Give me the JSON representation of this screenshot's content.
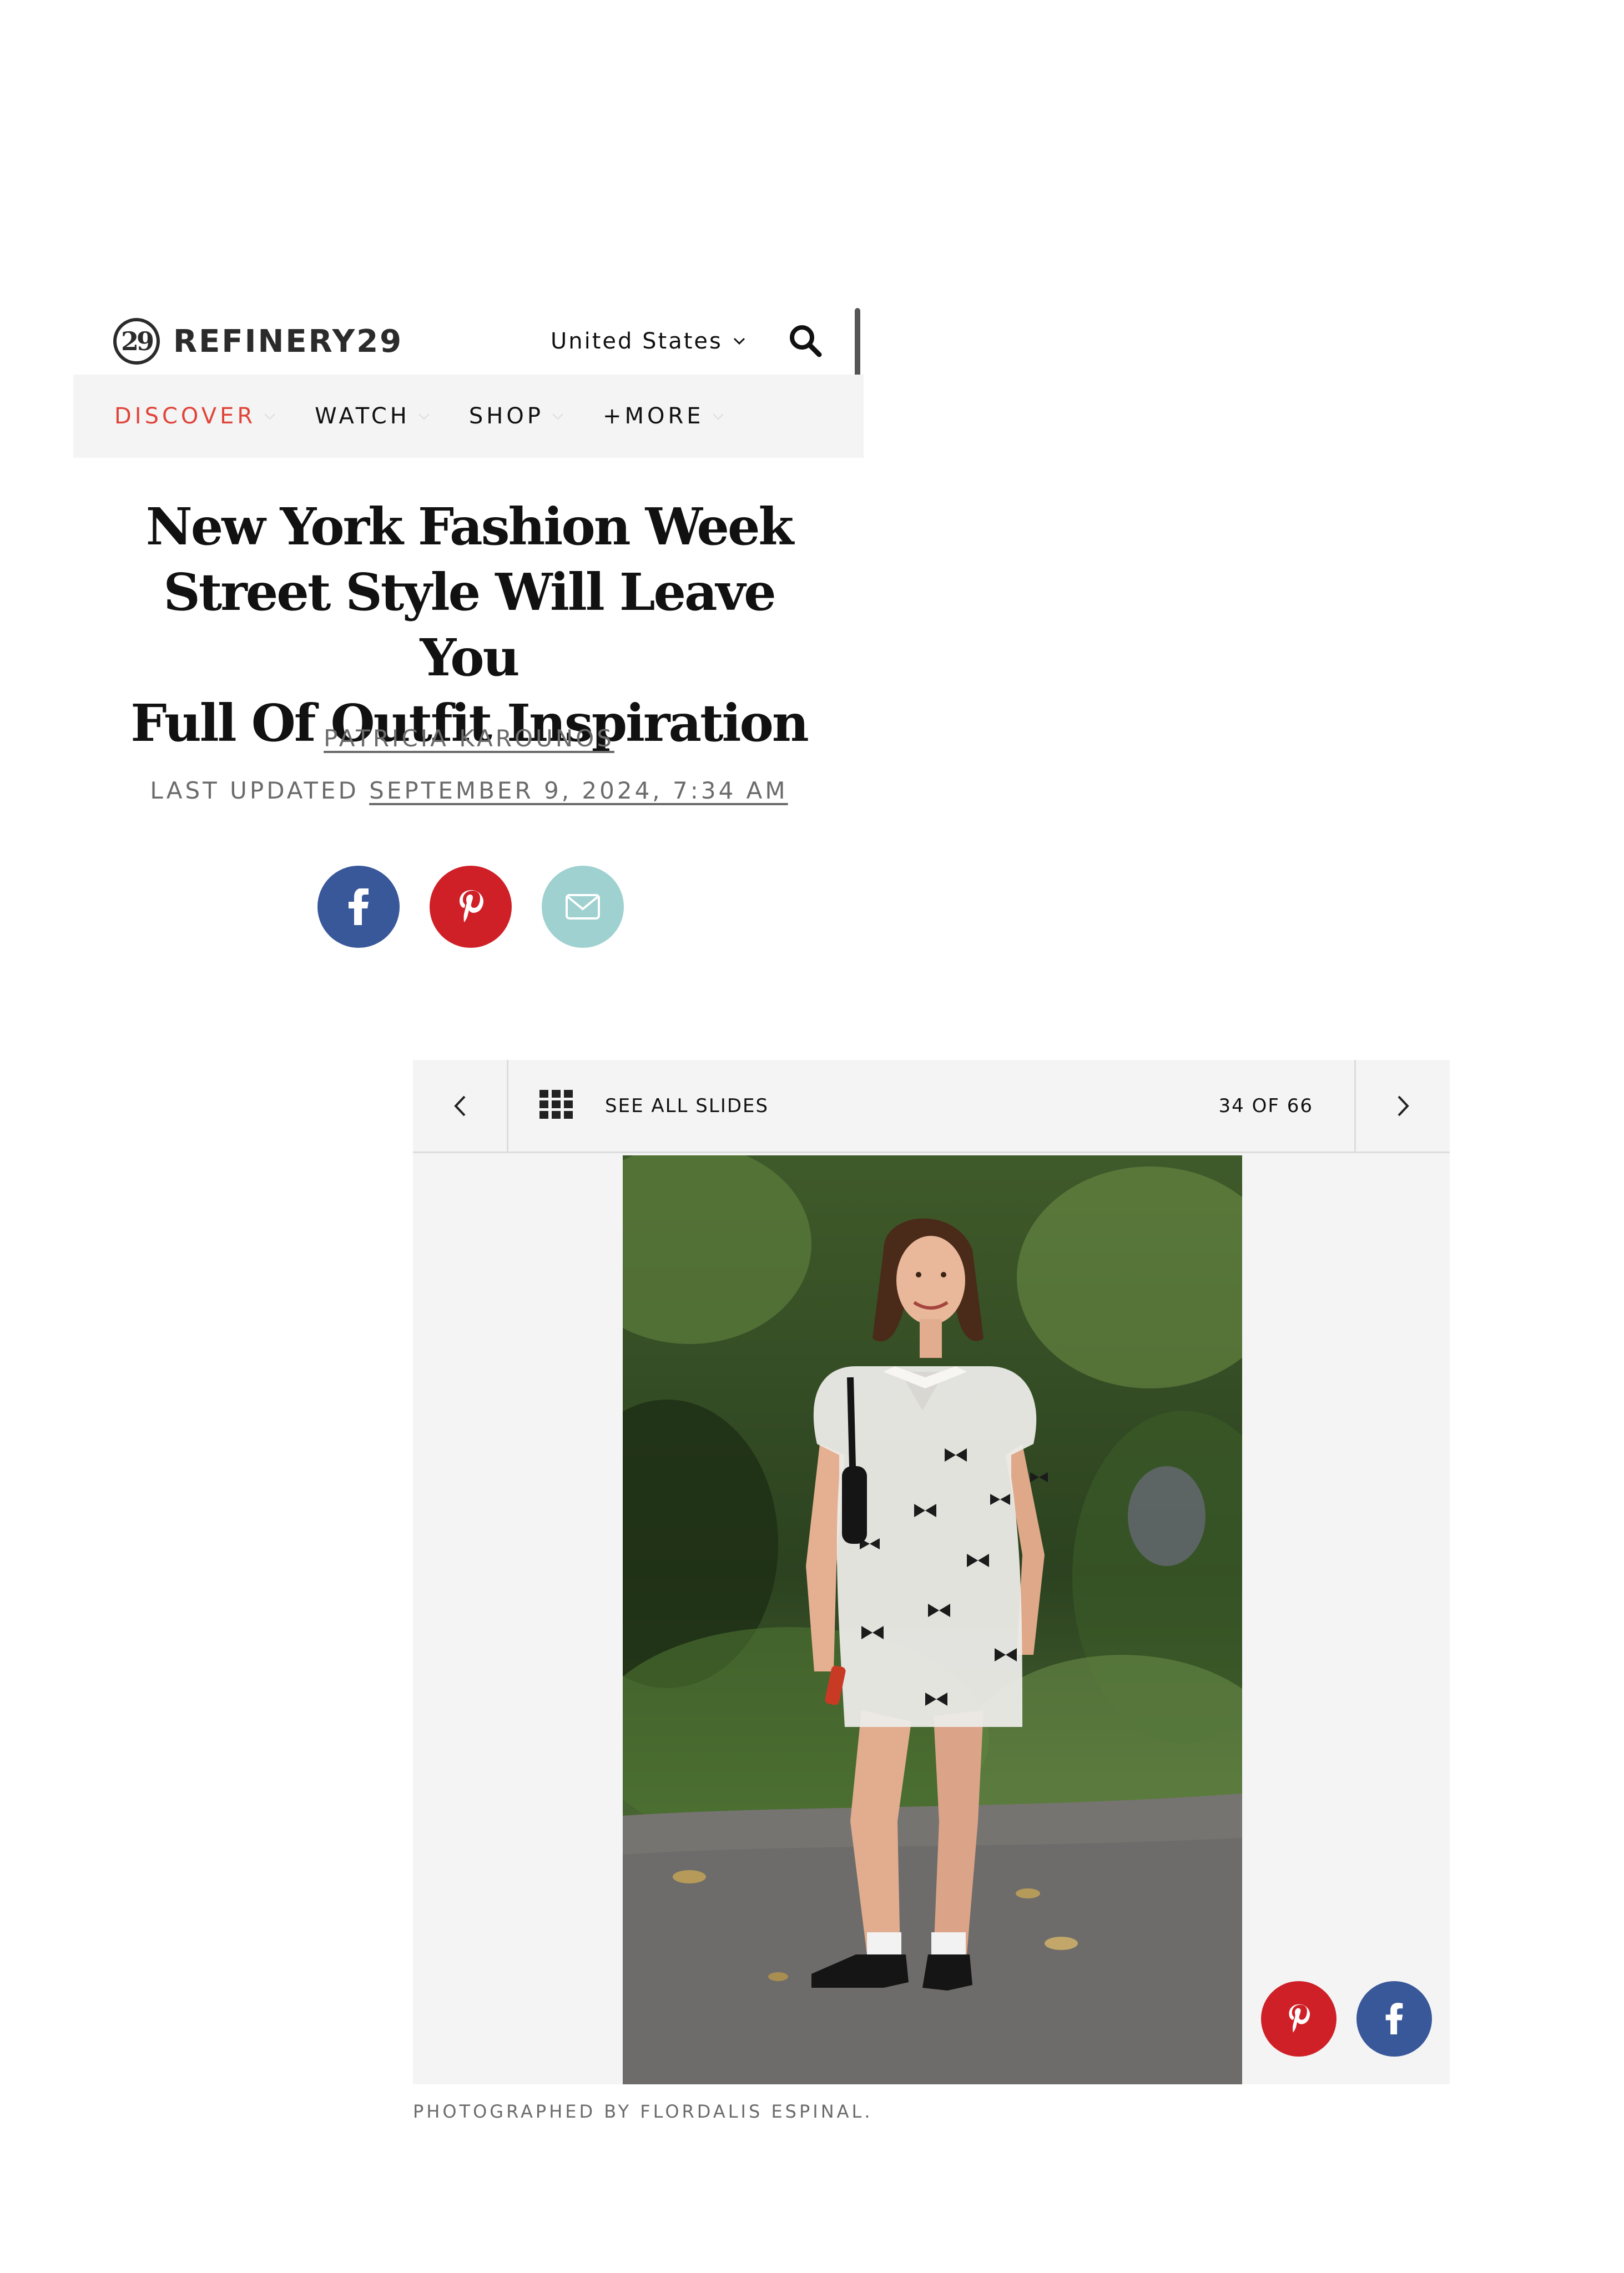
{
  "header": {
    "logo_mark": "29",
    "logo_text": "REFINERY29",
    "country_label": "United States"
  },
  "nav": {
    "items": [
      {
        "label": "DISCOVER",
        "active": true
      },
      {
        "label": "WATCH",
        "active": false
      },
      {
        "label": "SHOP",
        "active": false
      },
      {
        "label": "+MORE",
        "active": false
      }
    ]
  },
  "article": {
    "title_lines": [
      "New York Fashion Week",
      "Street Style Will Leave You",
      "Full Of Outfit Inspiration"
    ],
    "author": "PATRICIA KAROUNOS",
    "updated_prefix": "LAST UPDATED",
    "updated_date": "SEPTEMBER 9, 2024, 7:34 AM"
  },
  "share": {
    "icons": [
      "facebook-icon",
      "pinterest-icon",
      "email-icon"
    ]
  },
  "slideshow": {
    "see_all_label": "SEE ALL SLIDES",
    "counter": "34 OF 66",
    "credit": "PHOTOGRAPHED BY FLORDALIS ESPINAL."
  },
  "colors": {
    "accent_red": "#e0443a",
    "facebook_blue": "#39589a",
    "pinterest_red": "#cf2027",
    "email_teal": "#9ed1cf",
    "bar_gray": "#f4f4f4"
  }
}
